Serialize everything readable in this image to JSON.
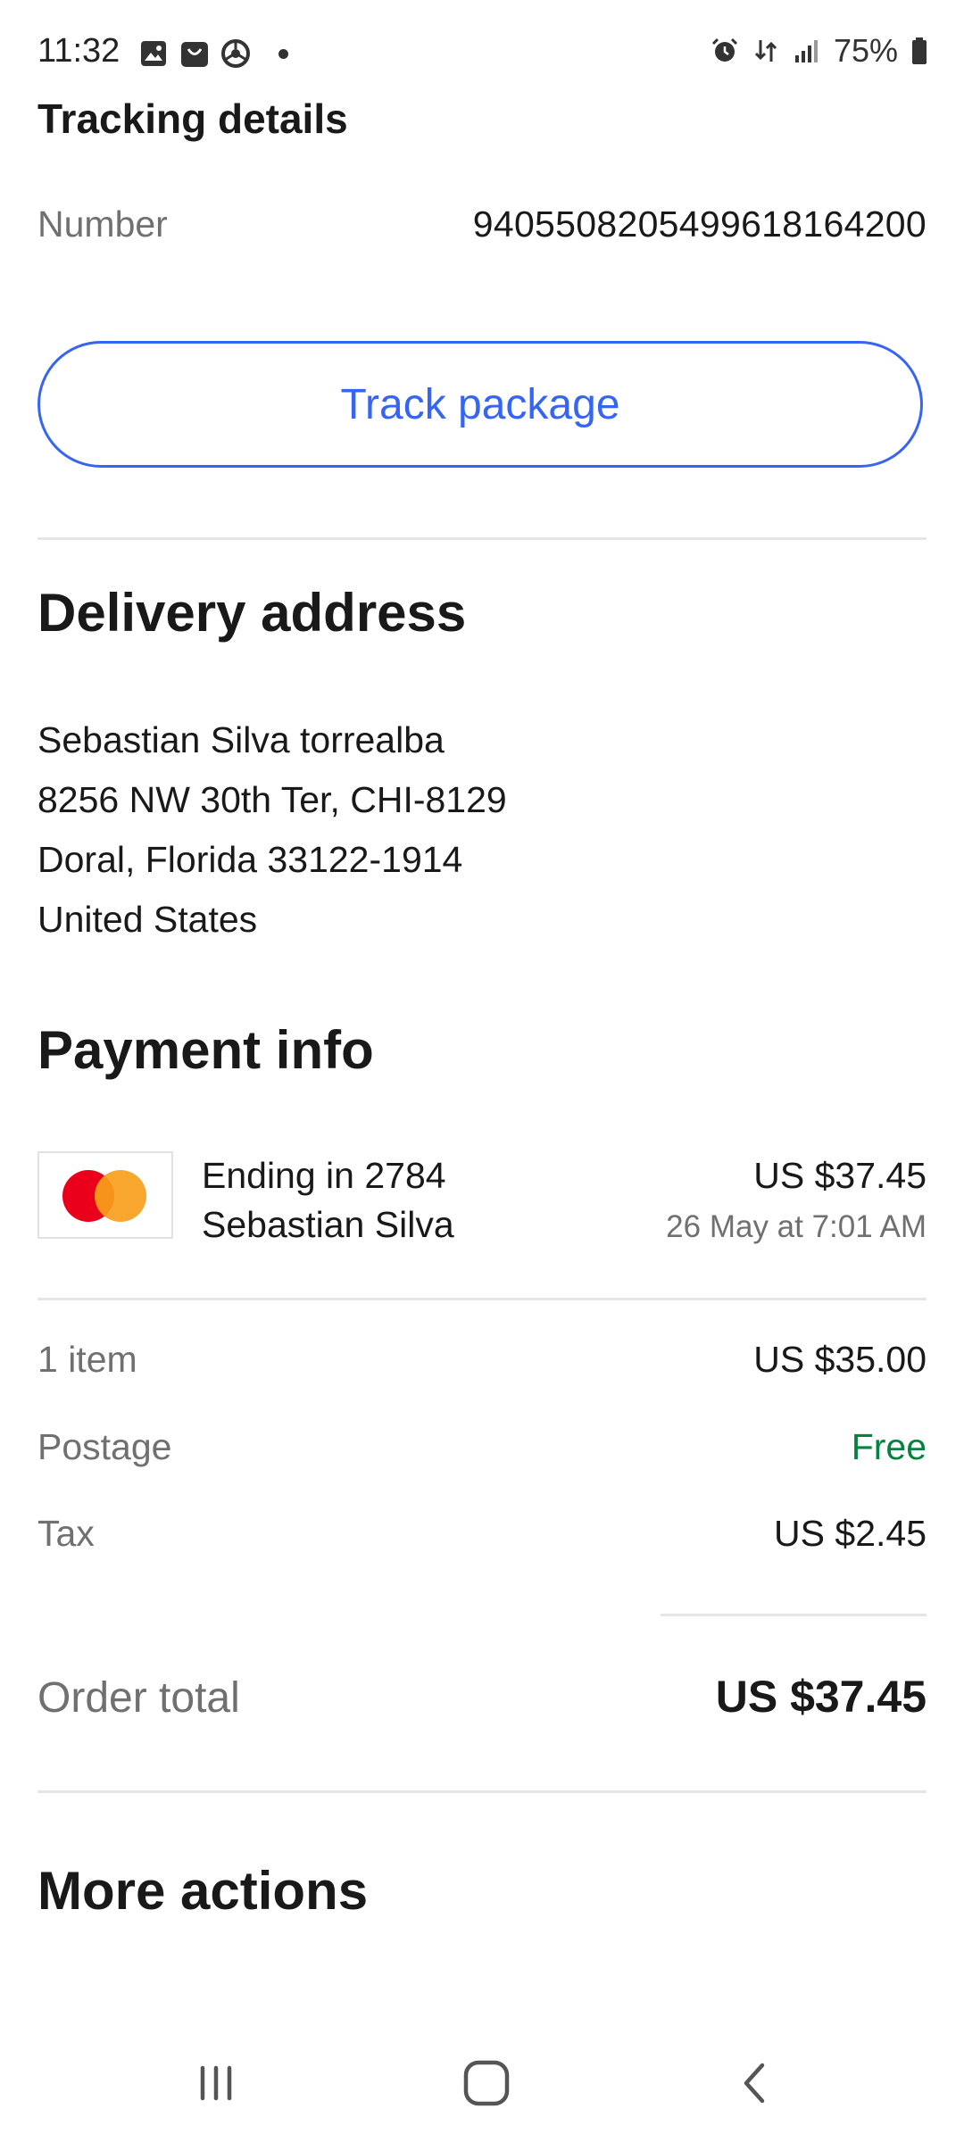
{
  "status_bar": {
    "time": "11:32",
    "battery": "75%",
    "left_icons": [
      "gallery-icon",
      "shopping-bag-icon",
      "chrome-icon"
    ],
    "right_icons": [
      "alarm-icon",
      "data-transfer-icon",
      "signal-icon",
      "battery-icon"
    ]
  },
  "tracking": {
    "title": "Tracking details",
    "number_label": "Number",
    "number_value": "9405508205499618164200",
    "track_button": "Track package"
  },
  "delivery": {
    "title": "Delivery address",
    "lines": [
      "Sebastian Silva torrealba",
      "8256 NW 30th Ter, CHI-8129",
      "Doral, Florida 33122-1914",
      "United States"
    ]
  },
  "payment": {
    "title": "Payment info",
    "card_brand_icon": "mastercard-icon",
    "card_ending": "Ending in 2784",
    "card_holder": "Sebastian Silva",
    "amount": "US $37.45",
    "date": "26 May at 7:01 AM"
  },
  "summary": {
    "items_label": "1 item",
    "items_value": "US $35.00",
    "postage_label": "Postage",
    "postage_value": "Free",
    "tax_label": "Tax",
    "tax_value": "US $2.45",
    "total_label": "Order total",
    "total_value": "US $37.45"
  },
  "more_actions": {
    "title": "More actions"
  },
  "nav_bar": {
    "buttons": [
      "recent-apps-icon",
      "home-icon",
      "back-icon"
    ]
  },
  "colors": {
    "accent": "#3665f3",
    "free": "#05823f",
    "text": "#191919",
    "muted": "#707070",
    "divider": "#e5e5e5"
  }
}
